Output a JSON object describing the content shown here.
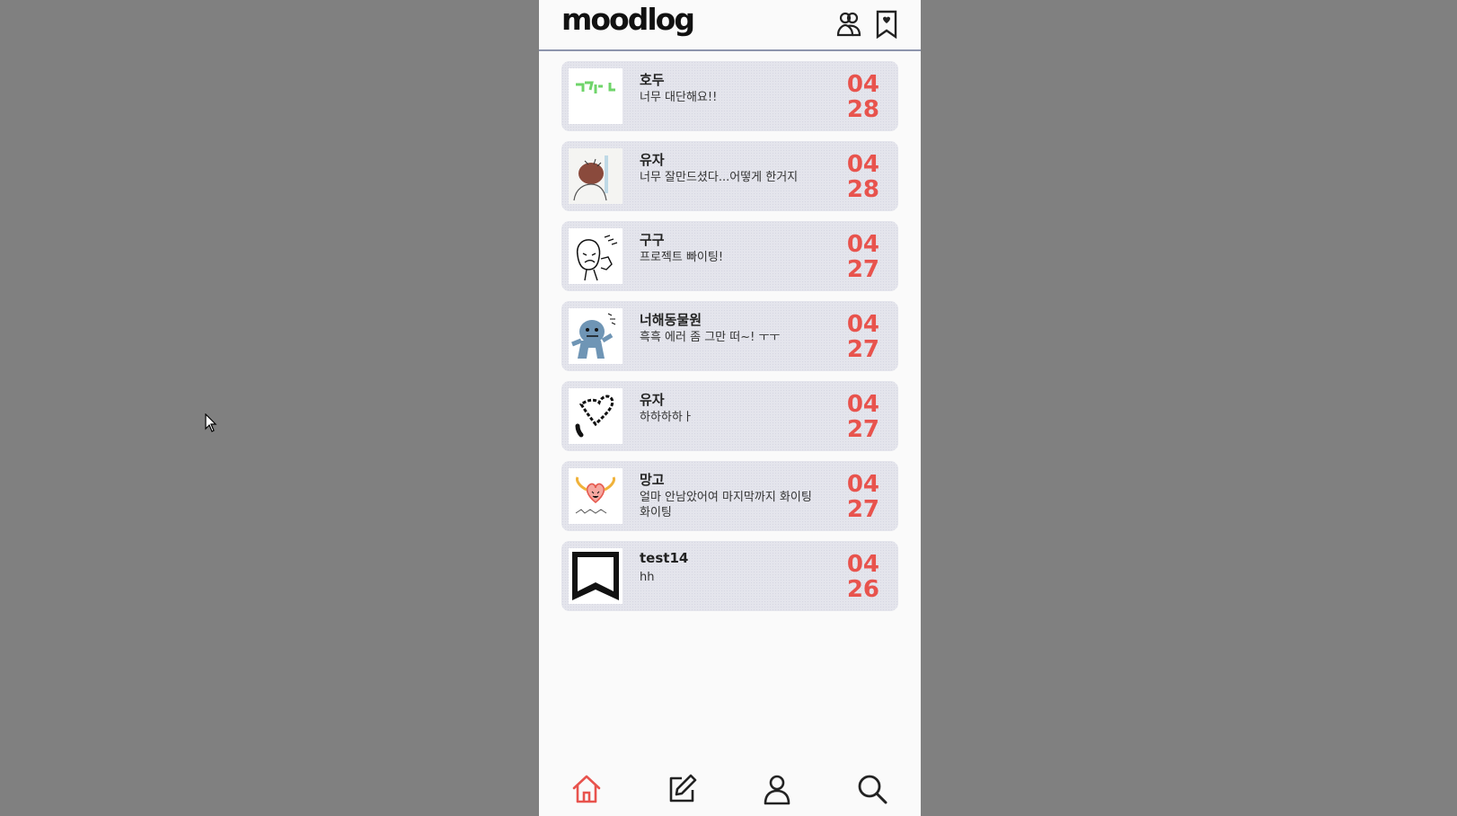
{
  "app": {
    "logo": "moodlog",
    "accent_color": "#e8534d"
  },
  "header": {
    "icons": [
      "friends-icon",
      "bookmark-heart-icon"
    ]
  },
  "feed": [
    {
      "name": "호두",
      "message": "너무 대단해요!!",
      "month": "04",
      "day": "28",
      "thumb": "green-doodle-drawing"
    },
    {
      "name": "유자",
      "message": "너무 잘만드셨다...어떻게 한거지",
      "month": "04",
      "day": "28",
      "thumb": "character-sketch-drawing"
    },
    {
      "name": "구구",
      "message": "프로젝트 빠이팅!",
      "month": "04",
      "day": "27",
      "thumb": "face-doodle-drawing"
    },
    {
      "name": "너해동물원",
      "message": "흑흑 에러 좀 그만 떠~! ㅜㅜ",
      "month": "04",
      "day": "27",
      "thumb": "blue-creature-drawing"
    },
    {
      "name": "유자",
      "message": "하하하하ㅏ",
      "month": "04",
      "day": "27",
      "thumb": "heart-doodle-drawing"
    },
    {
      "name": "망고",
      "message": "얼마 안남았어여 마지막까지 화이팅 화이팅",
      "month": "04",
      "day": "27",
      "thumb": "heart-arms-drawing"
    },
    {
      "name": "test14",
      "message": "hh",
      "month": "04",
      "day": "26",
      "thumb": "black-bookmark-drawing"
    }
  ],
  "bottom_nav": [
    {
      "icon": "home-icon",
      "active": true
    },
    {
      "icon": "edit-icon",
      "active": false
    },
    {
      "icon": "profile-icon",
      "active": false
    },
    {
      "icon": "search-icon",
      "active": false
    }
  ]
}
